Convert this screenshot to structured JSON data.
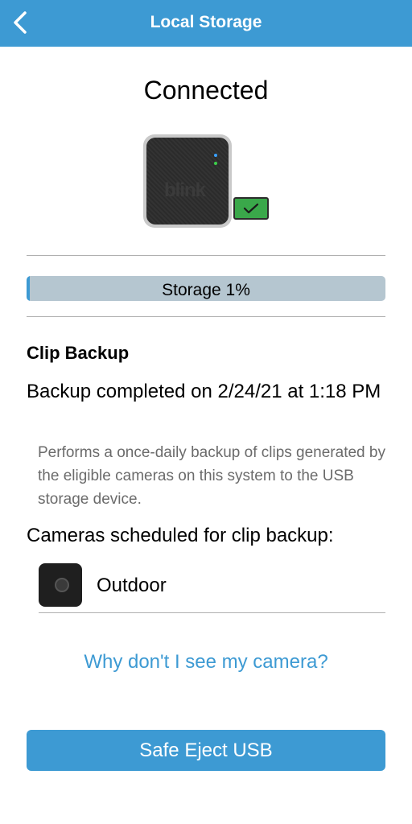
{
  "header": {
    "title": "Local Storage",
    "back_icon": "chevron-left-icon"
  },
  "device": {
    "status": "Connected",
    "brand_text": "blink",
    "check_icon": "checkmark-icon",
    "colors": {
      "badge": "#3aa84a"
    }
  },
  "storage": {
    "label": "Storage 1%",
    "percent": 1
  },
  "backup": {
    "section_title": "Clip Backup",
    "status": "Backup completed on 2/24/21 at 1:18 PM",
    "description": "Performs a once-daily backup of clips generated by the eligible cameras on this system to the USB storage device."
  },
  "cameras": {
    "heading": "Cameras scheduled for clip backup:",
    "items": [
      {
        "name": "Outdoor",
        "icon": "camera-icon"
      }
    ]
  },
  "help": {
    "link_text": "Why don't I see my camera?"
  },
  "actions": {
    "eject_label": "Safe Eject USB"
  },
  "colors": {
    "accent": "#3d9ad3",
    "storage_track": "#b5c6d0",
    "description_text": "#6b6b6b"
  }
}
